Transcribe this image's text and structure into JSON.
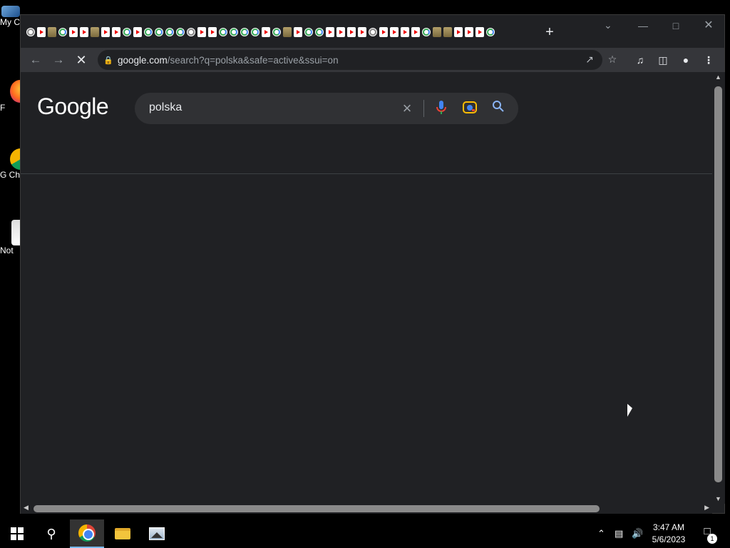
{
  "desktop": {
    "icons": [
      {
        "label": "My C"
      },
      {
        "label": "F"
      },
      {
        "label": "G Ch"
      },
      {
        "label": "Not"
      }
    ]
  },
  "browser": {
    "tab_favicons": [
      "gg",
      "yt",
      "img",
      "g",
      "yt",
      "yt",
      "img",
      "yt",
      "yt",
      "g",
      "yt",
      "g",
      "g",
      "g",
      "g",
      "gg",
      "yt",
      "yt",
      "g",
      "g",
      "g",
      "g",
      "yt",
      "g",
      "img",
      "yt",
      "g",
      "g",
      "yt",
      "yt",
      "yt",
      "yt",
      "gg",
      "yt",
      "yt",
      "yt",
      "yt",
      "g",
      "img",
      "img",
      "yt",
      "yt",
      "yt",
      "g"
    ],
    "new_tab_label": "+",
    "toolbar": {
      "url_host": "google.com",
      "url_path": "/search?q=polska&safe=active&ssui=on"
    },
    "page": {
      "logo": "Google",
      "search_value": "polska"
    }
  },
  "taskbar": {
    "time": "3:47 AM",
    "date": "5/6/2023",
    "notification_count": "1"
  },
  "colors": {
    "page_bg": "#202124",
    "toolbar_bg": "#35363a",
    "searchbox_bg": "#303134",
    "accent": "#8ab4f8"
  }
}
